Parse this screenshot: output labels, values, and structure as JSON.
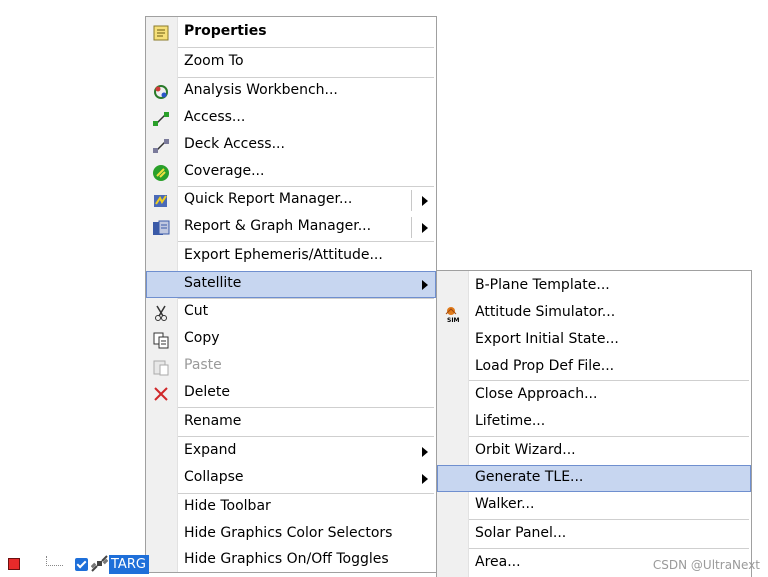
{
  "main_menu": {
    "items": [
      {
        "label": "Properties"
      },
      {
        "label": "Zoom To"
      },
      {
        "label": "Analysis Workbench..."
      },
      {
        "label": "Access..."
      },
      {
        "label": "Deck Access..."
      },
      {
        "label": "Coverage..."
      },
      {
        "label": "Quick Report Manager..."
      },
      {
        "label": "Report & Graph Manager..."
      },
      {
        "label": "Export Ephemeris/Attitude..."
      },
      {
        "label": "Satellite"
      },
      {
        "label": "Cut"
      },
      {
        "label": "Copy"
      },
      {
        "label": "Paste"
      },
      {
        "label": "Delete"
      },
      {
        "label": "Rename"
      },
      {
        "label": "Expand"
      },
      {
        "label": "Collapse"
      },
      {
        "label": "Hide Toolbar"
      },
      {
        "label": "Hide Graphics Color Selectors"
      },
      {
        "label": "Hide Graphics On/Off Toggles"
      }
    ]
  },
  "satellite_submenu": {
    "items": [
      {
        "label": "B-Plane Template..."
      },
      {
        "label": "Attitude Simulator..."
      },
      {
        "label": "Export Initial State..."
      },
      {
        "label": "Load Prop Def File..."
      },
      {
        "label": "Close Approach..."
      },
      {
        "label": "Lifetime..."
      },
      {
        "label": "Orbit Wizard..."
      },
      {
        "label": "Generate TLE..."
      },
      {
        "label": "Walker..."
      },
      {
        "label": "Solar Panel..."
      },
      {
        "label": "Area..."
      }
    ]
  },
  "tree": {
    "selected_label": "TARG"
  },
  "watermark": "CSDN @UltraNext",
  "colors": {
    "highlight": "#c7d6f0",
    "highlight_border": "#6f8fcf",
    "selection": "#1e6fd9"
  }
}
